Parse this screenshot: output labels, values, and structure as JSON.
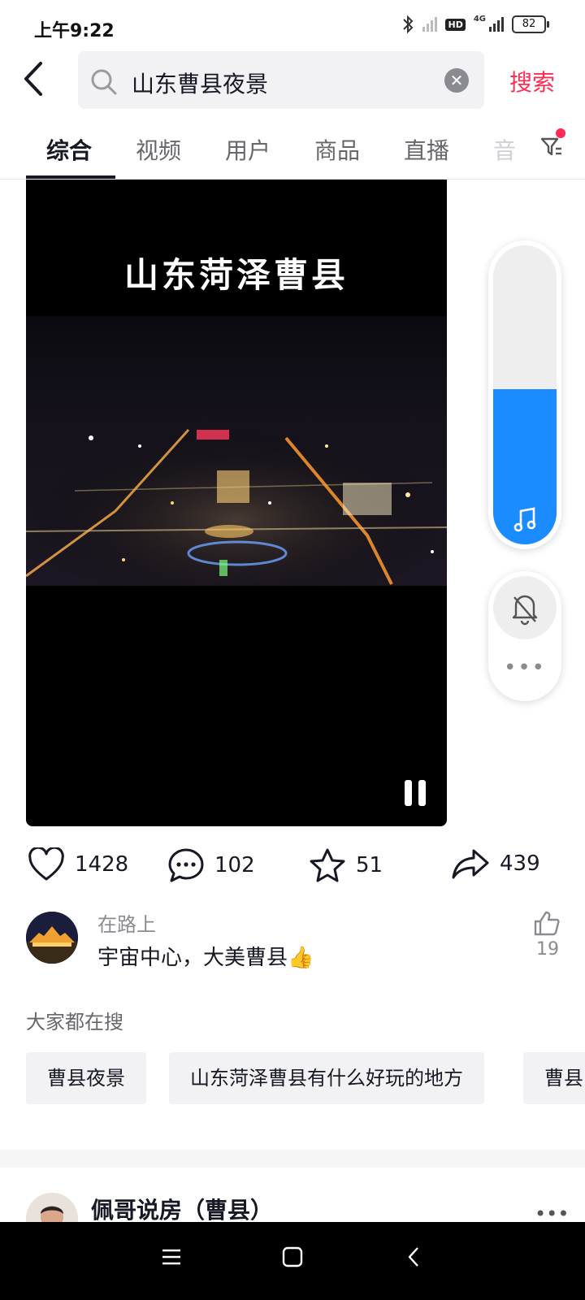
{
  "status": {
    "time": "上午9:22",
    "hd": "HD",
    "network": "4G",
    "battery": "82"
  },
  "search": {
    "query": "山东曹县夜景",
    "submit_label": "搜索"
  },
  "tabs": [
    {
      "label": "综合",
      "active": true
    },
    {
      "label": "视频"
    },
    {
      "label": "用户"
    },
    {
      "label": "商品"
    },
    {
      "label": "直播"
    },
    {
      "label": "音"
    }
  ],
  "video": {
    "overlay_title": "山东菏泽曹县",
    "state": "playing"
  },
  "volume": {
    "level": 0.52,
    "accent": "#1a8cff"
  },
  "actions": {
    "likes": "1428",
    "comments": "102",
    "favorites": "51",
    "shares": "439"
  },
  "comment": {
    "user": "在路上",
    "text": "宇宙中心，大美曹县👍",
    "likes": "19"
  },
  "related": {
    "title": "大家都在搜",
    "items": [
      "曹县夜景",
      "山东菏泽曹县有什么好玩的地方",
      "曹县"
    ]
  },
  "next_result": {
    "title": "佩哥说房（曹县）"
  },
  "colors": {
    "brand": "#fe2c55",
    "text": "#161823",
    "muted": "#8a8b91"
  }
}
